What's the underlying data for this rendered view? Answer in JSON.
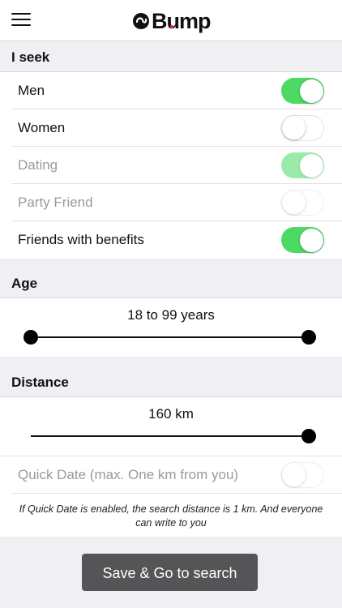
{
  "header": {
    "logo_text": "Bump",
    "menu_icon": "hamburger-menu-icon",
    "brand_color": "#e6262e"
  },
  "seek": {
    "title": "I seek",
    "items": [
      {
        "label": "Men",
        "on": true,
        "enabled": true
      },
      {
        "label": "Women",
        "on": false,
        "enabled": true
      },
      {
        "label": "Dating",
        "on": true,
        "enabled": false
      },
      {
        "label": "Party Friend",
        "on": false,
        "enabled": false
      },
      {
        "label": "Friends with benefits",
        "on": true,
        "enabled": true
      }
    ]
  },
  "age": {
    "title": "Age",
    "value_text": "18 to 99 years",
    "min": 18,
    "max": 99
  },
  "distance": {
    "title": "Distance",
    "value_text": "160 km",
    "value": 160,
    "max": 160
  },
  "quick_date": {
    "label": "Quick Date (max. One km from you)",
    "on": false,
    "note": "If Quick Date is enabled, the search distance is 1 km. And everyone can write to you"
  },
  "save_button": {
    "label": "Save & Go to search"
  },
  "colors": {
    "toggle_on": "#4cd964",
    "background": "#efeff4",
    "button": "#555557"
  }
}
